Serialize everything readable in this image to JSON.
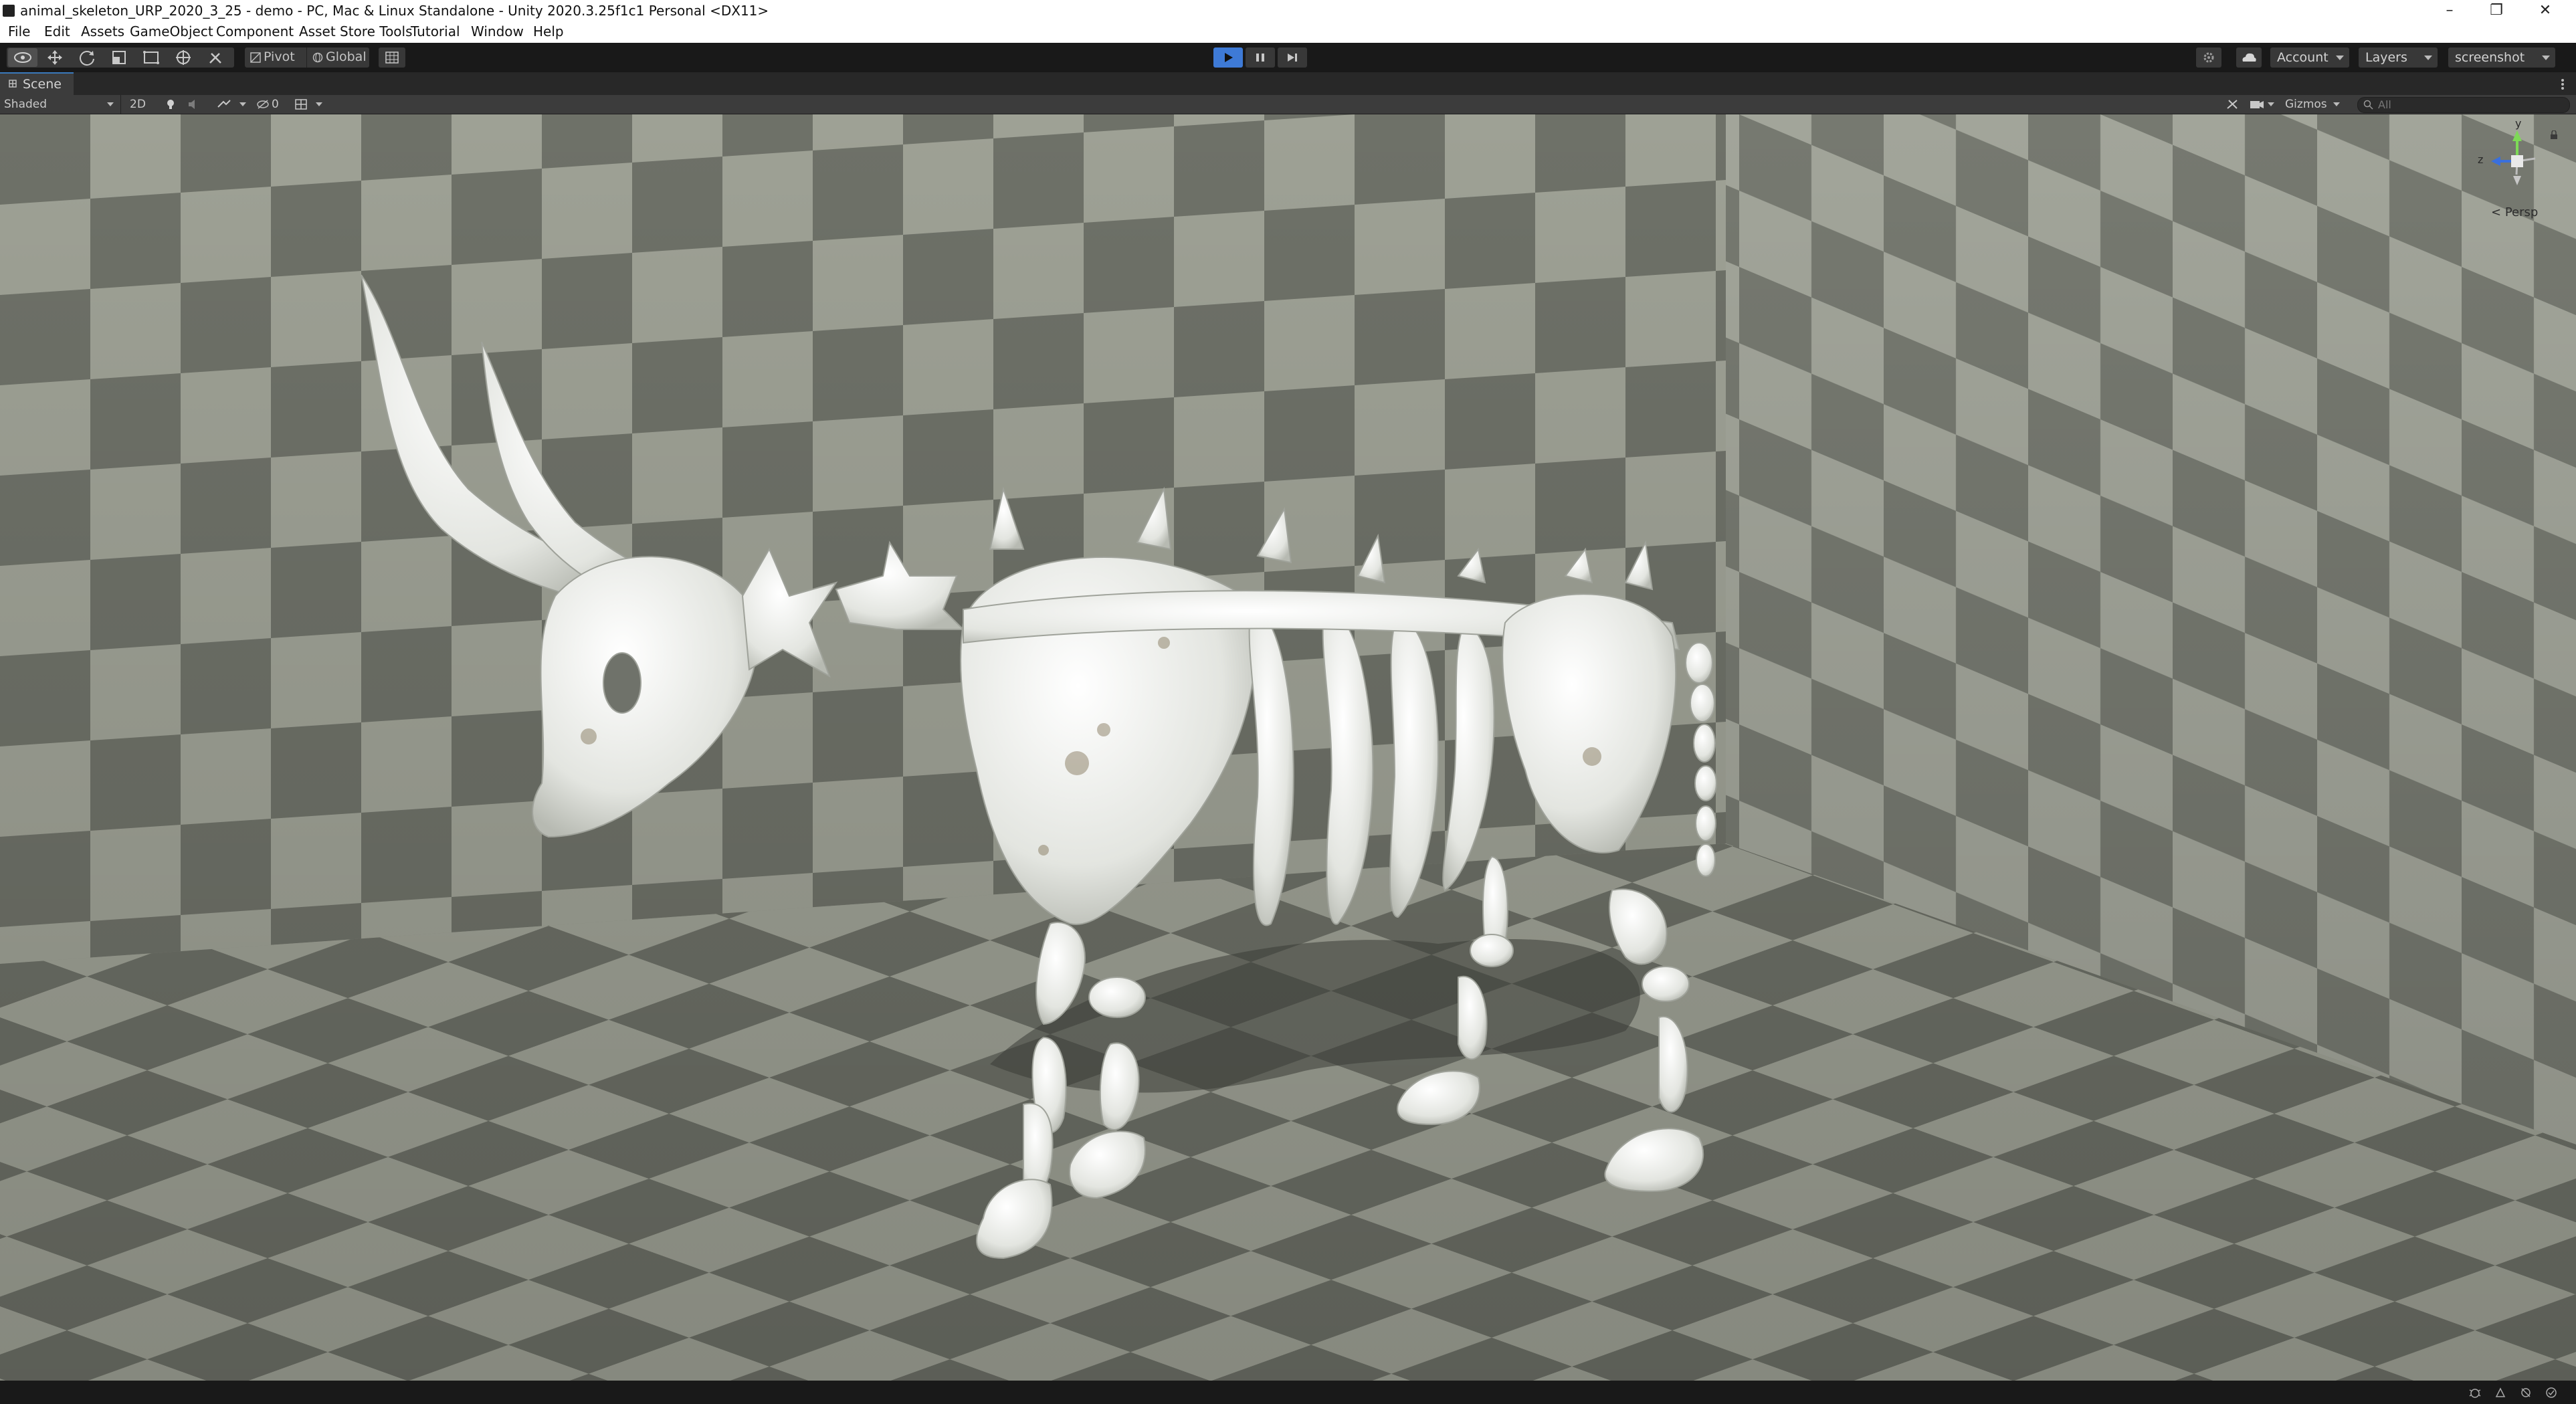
{
  "window": {
    "title": "animal_skeleton_URP_2020_3_25 - demo - PC, Mac & Linux Standalone - Unity 2020.3.25f1c1 Personal <DX11>",
    "minimize": "–",
    "restore": "❐",
    "close": "✕"
  },
  "menu": [
    "File",
    "Edit",
    "Assets",
    "GameObject",
    "Component",
    "Asset Store Tools",
    "Tutorial",
    "Window",
    "Help"
  ],
  "toolbar": {
    "pivot": "Pivot",
    "global": "Global",
    "account": "Account",
    "layers": "Layers",
    "layout": "screenshot"
  },
  "scene": {
    "tab_label": "Scene",
    "draw_mode": "Shaded",
    "mode_2d": "2D",
    "hidden_count": "0",
    "gizmos": "Gizmos",
    "search_placeholder": "All",
    "projection": "Persp",
    "axis_y": "y",
    "axis_z": "z"
  },
  "colors": {
    "play_active": "#3e7ad6",
    "toolbar_bg": "#191919",
    "button_bg": "#383838",
    "floor_dark": "#6c6f66",
    "floor_light": "#9ea195",
    "bone": "#e9ebe6"
  }
}
